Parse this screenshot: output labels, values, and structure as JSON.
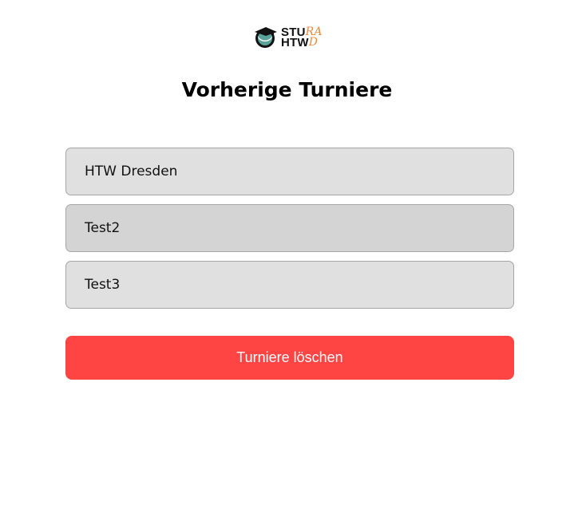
{
  "logo": {
    "line1_main": "STU",
    "line1_accent": "RA",
    "line2_main": "HTW",
    "line2_accent": "D",
    "colors": {
      "teal": "#5aa39a",
      "orange": "#e8893a",
      "dark": "#111111"
    }
  },
  "page_title": "Vorherige Turniere",
  "tournaments": [
    {
      "name": "HTW Dresden"
    },
    {
      "name": "Test2"
    },
    {
      "name": "Test3"
    }
  ],
  "delete_button": {
    "label": "Turniere löschen",
    "color": "#ff4444"
  }
}
